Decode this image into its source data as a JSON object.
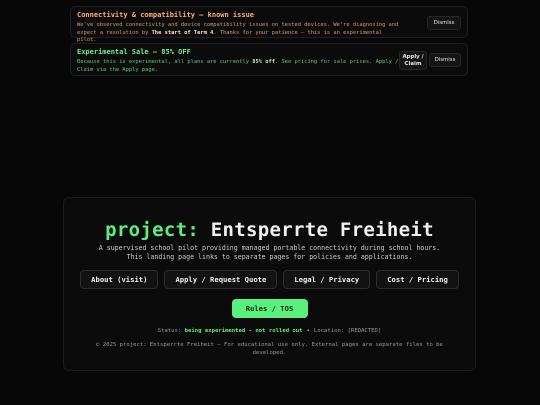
{
  "notices": [
    {
      "title": "Connectivity & compatibility — known issue",
      "body_1": "We've observed connectivity and device compatibility issues on tested devices. We're diagnosing and expect a resolution by ",
      "body_bold": "The start of Term 4",
      "body_2": ". Thanks for your patience — this is an experimental pilot.",
      "dismiss_label": "Dismiss"
    },
    {
      "title": "Experimental Sale — 85% OFF",
      "body_1": "Because this is experimental, all plans are currently ",
      "body_bold": "85% off",
      "body_2": ". See pricing for sale prices. Apply / Claim via the Apply page.",
      "apply_label": "Apply / Claim",
      "dismiss_label": "Dismiss"
    }
  ],
  "hero": {
    "title_prefix": "project:",
    "title_rest": " Entsperrte Freiheit",
    "subtitle": "A supervised school pilot providing managed portable connectivity during school hours. This landing page links to separate pages for policies and applications.",
    "links": [
      "About (visit)",
      "Apply / Request Quote",
      "Legal / Privacy",
      "Cost / Pricing"
    ],
    "rules_label": "Rules / TOS",
    "status_label": "Status:",
    "status_value": "being experimented - not rolled out",
    "status_sep": "•",
    "location_label": "Location:",
    "location_value": "[REDACTED]",
    "footer": "© 2025 project: Entsperrte Freiheit — For educational use only. External pages are separate files to be developed."
  },
  "colors": {
    "accent": "#5af07c",
    "warning": "#ffb070",
    "background": "#070707"
  }
}
